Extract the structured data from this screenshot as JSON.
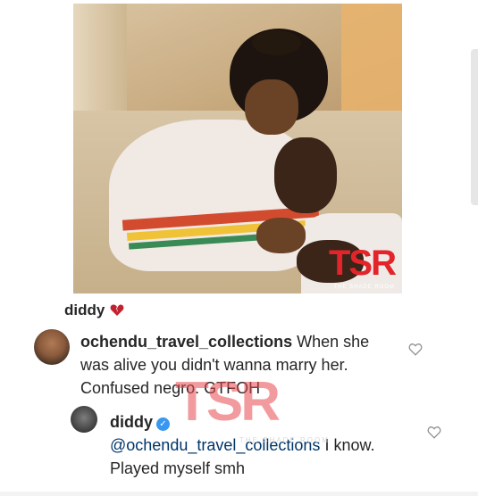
{
  "post": {
    "caption_user": "diddy",
    "watermark_badge": "TSR",
    "watermark_sub": "THE SHADE ROOM"
  },
  "comments": [
    {
      "username": "ochendu_travel_collections",
      "text": "When she was alive you didn't wanna marry her. Confused negro. GTFOH"
    },
    {
      "username": "diddy",
      "verified": true,
      "mention": "@ochendu_travel_collections",
      "text": "I know. Played myself smh"
    }
  ],
  "colors": {
    "link": "#003569",
    "verified": "#3897f0",
    "heart": "#c0232f",
    "watermark": "#e3242b"
  },
  "icons": {
    "caption": "broken-heart-icon",
    "like": "heart-outline-icon",
    "verified": "verified-badge-icon"
  }
}
